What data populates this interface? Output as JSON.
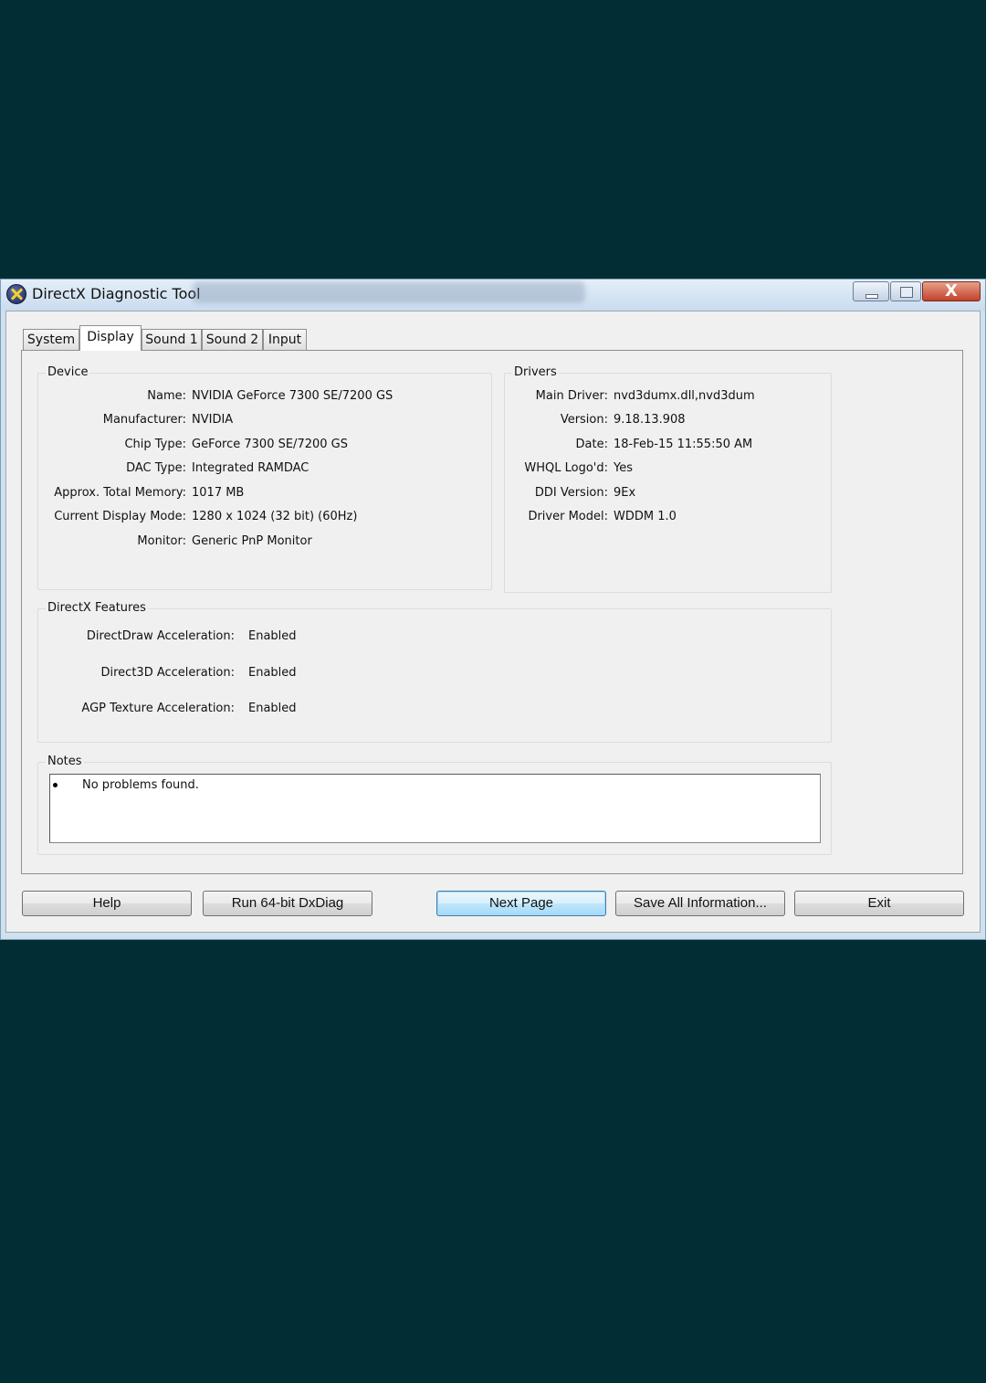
{
  "window": {
    "title": "DirectX Diagnostic Tool",
    "close_glyph": "X"
  },
  "tabs": [
    {
      "label": "System"
    },
    {
      "label": "Display",
      "active": true
    },
    {
      "label": "Sound 1"
    },
    {
      "label": "Sound 2"
    },
    {
      "label": "Input"
    }
  ],
  "device": {
    "label": "Device",
    "rows": [
      {
        "key": "Name:",
        "value": "NVIDIA GeForce 7300 SE/7200 GS"
      },
      {
        "key": "Manufacturer:",
        "value": "NVIDIA"
      },
      {
        "key": "Chip Type:",
        "value": "GeForce 7300 SE/7200 GS"
      },
      {
        "key": "DAC Type:",
        "value": "Integrated RAMDAC"
      },
      {
        "key": "Approx. Total Memory:",
        "value": "1017 MB"
      },
      {
        "key": "Current Display Mode:",
        "value": "1280 x 1024 (32 bit) (60Hz)"
      },
      {
        "key": "Monitor:",
        "value": "Generic PnP Monitor"
      }
    ]
  },
  "drivers": {
    "label": "Drivers",
    "rows": [
      {
        "key": "Main Driver:",
        "value": "nvd3dumx.dll,nvd3dum"
      },
      {
        "key": "Version:",
        "value": "9.18.13.908"
      },
      {
        "key": "Date:",
        "value": "18-Feb-15 11:55:50 AM"
      },
      {
        "key": "WHQL Logo'd:",
        "value": "Yes"
      },
      {
        "key": "DDI Version:",
        "value": "9Ex"
      },
      {
        "key": "Driver Model:",
        "value": "WDDM 1.0"
      }
    ]
  },
  "features": {
    "label": "DirectX Features",
    "rows": [
      {
        "key": "DirectDraw Acceleration:",
        "value": "Enabled"
      },
      {
        "key": "Direct3D Acceleration:",
        "value": "Enabled"
      },
      {
        "key": "AGP Texture Acceleration:",
        "value": "Enabled"
      }
    ]
  },
  "notes": {
    "label": "Notes",
    "items": [
      "No problems found."
    ]
  },
  "buttons": {
    "help": "Help",
    "run64": "Run 64-bit DxDiag",
    "next": "Next Page",
    "save": "Save All Information...",
    "exit": "Exit"
  },
  "colors": {
    "background": "#032d35",
    "dialog": "#f0f0f0",
    "default_button_border": "#3c7fb1"
  }
}
